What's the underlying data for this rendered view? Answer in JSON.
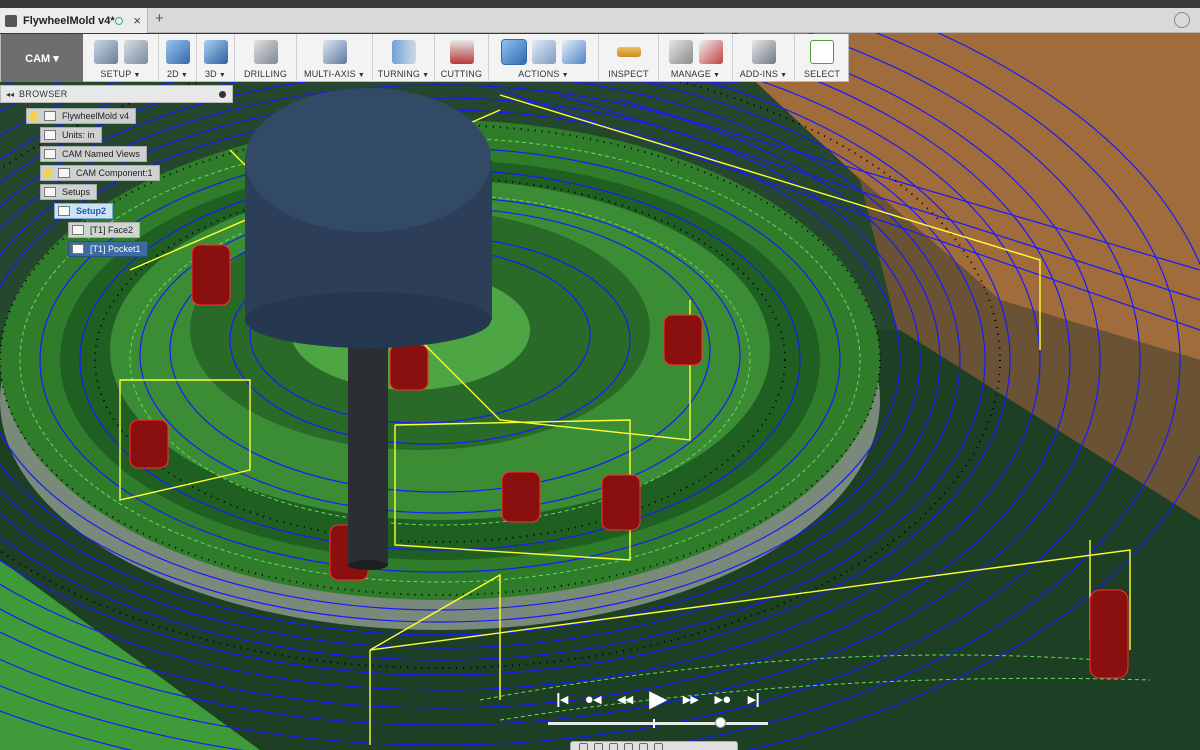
{
  "document": {
    "tab_title": "FlywheelMold v4*",
    "close_glyph": "×",
    "add_tab_glyph": "+"
  },
  "toolbar": {
    "workspace": "CAM ▾",
    "groups": [
      {
        "label": "SETUP",
        "dropdown": true
      },
      {
        "label": "2D",
        "dropdown": true
      },
      {
        "label": "3D",
        "dropdown": true
      },
      {
        "label": "DRILLING",
        "dropdown": false
      },
      {
        "label": "MULTI-AXIS",
        "dropdown": true
      },
      {
        "label": "TURNING",
        "dropdown": true
      },
      {
        "label": "CUTTING",
        "dropdown": false
      },
      {
        "label": "ACTIONS",
        "dropdown": true
      },
      {
        "label": "INSPECT",
        "dropdown": false
      },
      {
        "label": "MANAGE",
        "dropdown": true
      },
      {
        "label": "ADD-INS",
        "dropdown": true
      },
      {
        "label": "SELECT",
        "dropdown": false
      }
    ]
  },
  "browser": {
    "title": "BROWSER",
    "collapse_glyph": "◂◂",
    "nodes": [
      {
        "label": "FlywheelMold v4"
      },
      {
        "label": "Units: in"
      },
      {
        "label": "CAM Named Views"
      },
      {
        "label": "CAM Component:1"
      },
      {
        "label": "Setups"
      },
      {
        "label": "Setup2"
      },
      {
        "label": "[T1] Face2"
      },
      {
        "label": "[T1] Pocket1"
      }
    ]
  },
  "playback": {
    "controls": [
      "|◂",
      "●◂",
      "◂◂",
      "▶",
      "▸▸",
      "▸●",
      "▸|"
    ],
    "progress": 0.78,
    "marker": 0.48
  },
  "colors": {
    "toolpath": "#1a1aff",
    "rapid": "#ffff33",
    "stock": "#2e7d32",
    "tool": "#2a3e5c",
    "part_bg": "#9a6a3a"
  }
}
